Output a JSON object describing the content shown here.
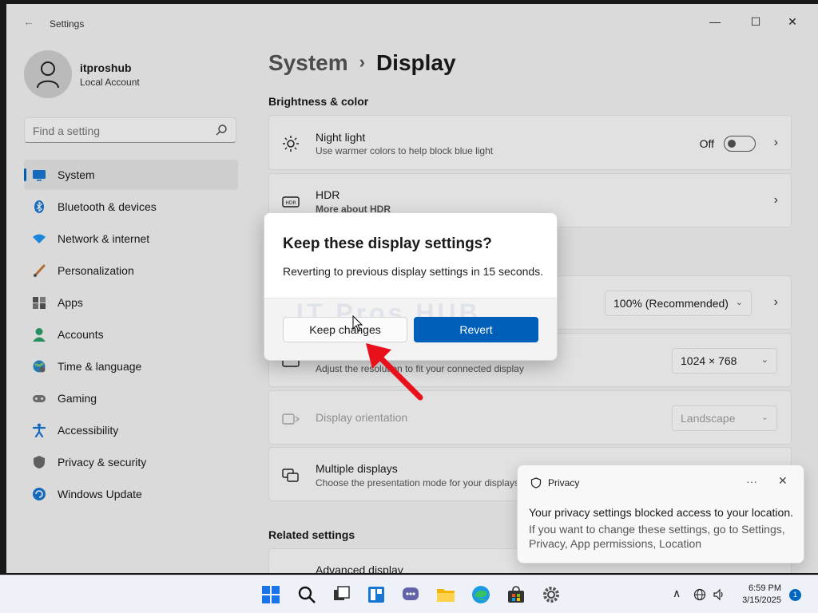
{
  "window": {
    "app_title": "Settings",
    "controls": [
      "minimize",
      "maximize",
      "close"
    ]
  },
  "user": {
    "name": "itproshub",
    "account_type": "Local Account"
  },
  "search": {
    "placeholder": "Find a setting"
  },
  "sidebar": {
    "items": [
      {
        "label": "System",
        "icon": "monitor-icon",
        "active": true
      },
      {
        "label": "Bluetooth & devices",
        "icon": "bluetooth-icon"
      },
      {
        "label": "Network & internet",
        "icon": "wifi-icon"
      },
      {
        "label": "Personalization",
        "icon": "brush-icon"
      },
      {
        "label": "Apps",
        "icon": "apps-icon"
      },
      {
        "label": "Accounts",
        "icon": "accounts-icon"
      },
      {
        "label": "Time & language",
        "icon": "globe-clock-icon"
      },
      {
        "label": "Gaming",
        "icon": "gamepad-icon"
      },
      {
        "label": "Accessibility",
        "icon": "accessibility-icon"
      },
      {
        "label": "Privacy & security",
        "icon": "shield-icon"
      },
      {
        "label": "Windows Update",
        "icon": "update-icon"
      }
    ]
  },
  "breadcrumb": {
    "parent": "System",
    "current": "Display"
  },
  "sections": {
    "brightness": "Brightness & color",
    "related": "Related settings"
  },
  "cards": {
    "night_light": {
      "title": "Night light",
      "subtitle": "Use warmer colors to help block blue light",
      "state_label": "Off"
    },
    "hdr": {
      "title": "HDR",
      "link": "More about HDR"
    },
    "scale": {
      "value": "100% (Recommended)"
    },
    "resolution": {
      "subtitle": "Adjust the resolution to fit your connected display",
      "value": "1024 × 768"
    },
    "orientation": {
      "title": "Display orientation",
      "value": "Landscape"
    },
    "multiple": {
      "title": "Multiple displays",
      "subtitle": "Choose the presentation mode for your displays"
    },
    "advanced": {
      "title": "Advanced display"
    }
  },
  "dialog": {
    "title": "Keep these display settings?",
    "message": "Reverting to previous display settings in 15 seconds.",
    "keep_label": "Keep changes",
    "revert_label": "Revert",
    "watermark": "IT Pros HUB"
  },
  "toast": {
    "app": "Privacy",
    "more": "···",
    "close": "✕",
    "title": "Your privacy settings blocked access to your location.",
    "body": "If you want to change these settings, go to Settings, Privacy, App permissions, Location"
  },
  "taskbar": {
    "time": "6:59 PM",
    "date": "3/15/2025",
    "notification_count": "1"
  },
  "colors": {
    "accent": "#005fb8",
    "arrow": "#e8101a"
  }
}
